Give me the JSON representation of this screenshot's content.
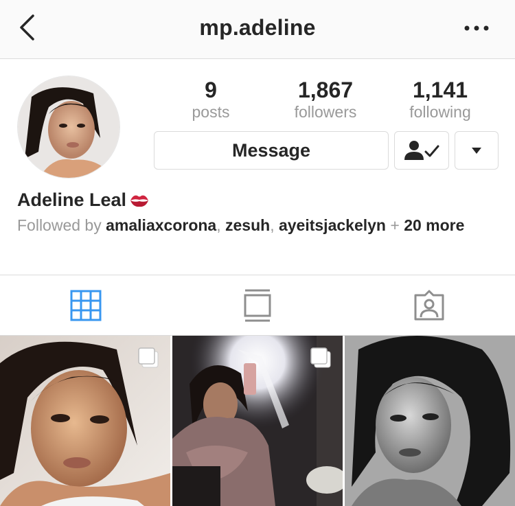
{
  "header": {
    "username": "mp.adeline"
  },
  "profile": {
    "full_name": "Adeline Leal",
    "stats": [
      {
        "value": "9",
        "label": "posts"
      },
      {
        "value": "1,867",
        "label": "followers"
      },
      {
        "value": "1,141",
        "label": "following"
      }
    ],
    "followed_by_prefix": "Followed by",
    "followed_by_users": [
      "amaliaxcorona",
      "zesuh",
      "ayeitsjackelyn"
    ],
    "followed_by_plus": "+",
    "followed_by_more": "20 more"
  },
  "actions": {
    "message_label": "Message"
  },
  "tabs": [
    {
      "name": "grid",
      "icon": "grid-icon",
      "active": true
    },
    {
      "name": "feed",
      "icon": "feed-icon",
      "active": false
    },
    {
      "name": "tagged",
      "icon": "tagged-icon",
      "active": false
    }
  ],
  "posts": [
    {
      "type": "carousel",
      "icon": "multiple-photos-icon"
    },
    {
      "type": "carousel",
      "icon": "multiple-photos-icon"
    },
    {
      "type": "single"
    }
  ],
  "colors": {
    "accent": "#3897f0",
    "text": "#262626",
    "muted": "#999999",
    "border": "#dbdbdb"
  }
}
